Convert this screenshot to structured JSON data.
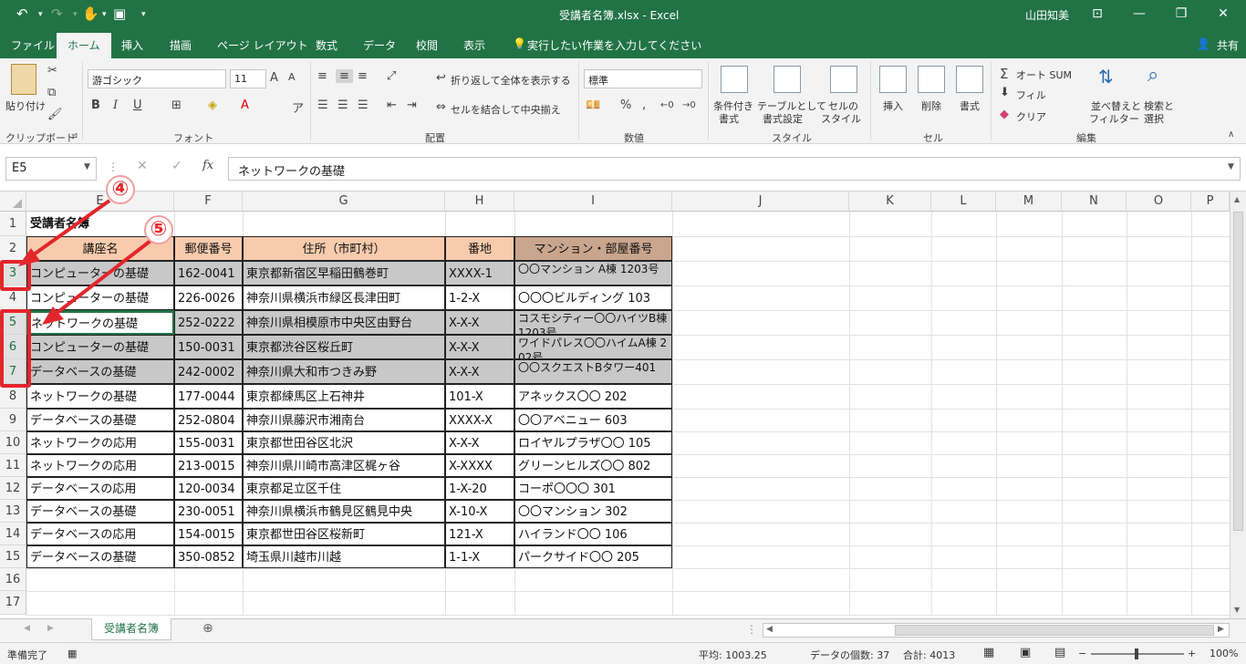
{
  "window": {
    "title": "受講者名簿.xlsx - Excel",
    "user": "山田知美",
    "share": "共有",
    "tell_me": "実行したい作業を入力してください"
  },
  "tabs": [
    "ファイル",
    "ホーム",
    "挿入",
    "描画",
    "ページ レイアウト",
    "数式",
    "データ",
    "校閲",
    "表示"
  ],
  "ribbon": {
    "clipboard": {
      "label": "クリップボード",
      "paste": "貼り付け"
    },
    "font": {
      "label": "フォント",
      "name": "游ゴシック",
      "size": "11",
      "bold": "B",
      "italic": "I",
      "underline": "U"
    },
    "alignment": {
      "label": "配置",
      "wrap": "折り返して全体を表示する",
      "merge": "セルを結合して中央揃え"
    },
    "number": {
      "label": "数値",
      "format": "標準",
      "percent": "%",
      "comma": ","
    },
    "styles": {
      "label": "スタイル",
      "cond1": "条件付き",
      "cond2": "書式",
      "table1": "テーブルとして",
      "table2": "書式設定",
      "cell1": "セルの",
      "cell2": "スタイル"
    },
    "cells": {
      "label": "セル",
      "insert": "挿入",
      "delete": "削除",
      "format": "書式"
    },
    "editing": {
      "label": "編集",
      "autosum": "オート SUM",
      "fill": "フィル",
      "clear": "クリア",
      "sort1": "並べ替えと",
      "sort2": "フィルター",
      "find1": "検索と",
      "find2": "選択"
    }
  },
  "formula_bar": {
    "name_box": "E5",
    "formula": "ネットワークの基礎"
  },
  "columns": [
    "E",
    "F",
    "G",
    "H",
    "I",
    "J",
    "K",
    "L",
    "M",
    "N",
    "O",
    "P"
  ],
  "rows": [
    "1",
    "2",
    "3",
    "4",
    "5",
    "6",
    "7",
    "8",
    "9",
    "10",
    "11",
    "12",
    "13",
    "14",
    "15",
    "16",
    "17"
  ],
  "sheet_title": "受講者名簿",
  "headers": [
    "講座名",
    "郵便番号",
    "住所（市町村）",
    "番地",
    "マンション・部屋番号"
  ],
  "records": [
    [
      "コンピューターの基礎",
      "162-0041",
      "東京都新宿区早稲田鶴巻町",
      "XXXX-1",
      "〇〇マンション A棟 1203号"
    ],
    [
      "コンピューターの基礎",
      "226-0026",
      "神奈川県横浜市緑区長津田町",
      "1-2-X",
      "〇〇〇ビルディング 103"
    ],
    [
      "ネットワークの基礎",
      "252-0222",
      "神奈川県相模原市中央区由野台",
      "X-X-X",
      "コスモシティー〇〇ハイツB棟 1203号"
    ],
    [
      "コンピューターの基礎",
      "150-0031",
      "東京都渋谷区桜丘町",
      "X-X-X",
      "ワイドパレス〇〇ハイムA棟 202号"
    ],
    [
      "データベースの基礎",
      "242-0002",
      "神奈川県大和市つきみ野",
      "X-X-X",
      "〇〇スクエストBタワー401"
    ],
    [
      "ネットワークの基礎",
      "177-0044",
      "東京都練馬区上石神井",
      "101-X",
      "アネックス〇〇 202"
    ],
    [
      "データベースの基礎",
      "252-0804",
      "神奈川県藤沢市湘南台",
      "XXXX-X",
      "〇〇アベニュー 603"
    ],
    [
      "ネットワークの応用",
      "155-0031",
      "東京都世田谷区北沢",
      "X-X-X",
      "ロイヤルプラザ〇〇 105"
    ],
    [
      "ネットワークの応用",
      "213-0015",
      "神奈川県川崎市高津区梶ヶ谷",
      "X-XXXX",
      "グリーンヒルズ〇〇 802"
    ],
    [
      "データベースの応用",
      "120-0034",
      "東京都足立区千住",
      "1-X-20",
      "コーポ〇〇〇 301"
    ],
    [
      "データベースの基礎",
      "230-0051",
      "神奈川県横浜市鶴見区鶴見中央",
      "X-10-X",
      "〇〇マンション 302"
    ],
    [
      "データベースの応用",
      "154-0015",
      "東京都世田谷区桜新町",
      "121-X",
      "ハイランド〇〇 106"
    ],
    [
      "データベースの基礎",
      "350-0852",
      "埼玉県川越市川越",
      "1-1-X",
      "パークサイド〇〇 205"
    ]
  ],
  "callouts": [
    "④",
    "⑤"
  ],
  "sheet_tab": "受講者名簿",
  "status": {
    "ready": "準備完了",
    "average": "平均: 1003.25",
    "count": "データの個数: 37",
    "sum": "合計: 4013",
    "zoom": "100%"
  },
  "colors": {
    "accent": "#217346",
    "header_fill": "#f8cbad",
    "selected_header_fill": "#c9a58d",
    "highlight": "#c8c8c8",
    "callout": "#e3262b"
  }
}
